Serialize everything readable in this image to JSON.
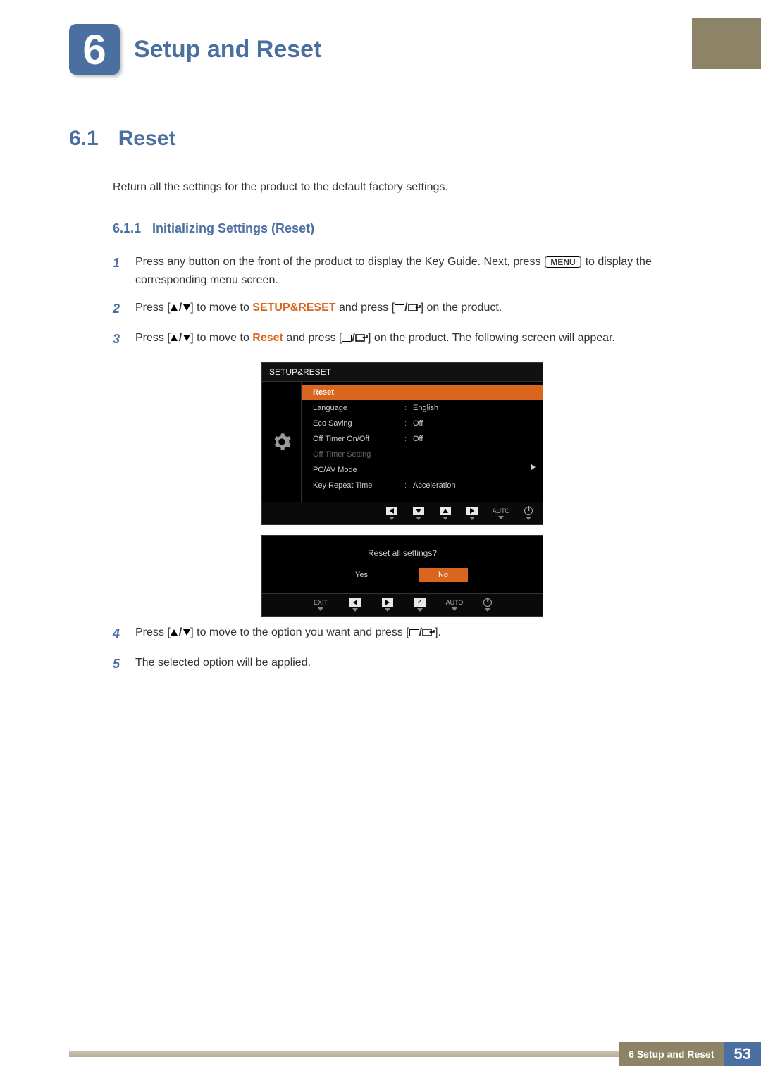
{
  "chapter": {
    "num": "6",
    "title": "Setup and Reset"
  },
  "section": {
    "num": "6.1",
    "title": "Reset"
  },
  "intro": "Return all the settings for the product to the default factory settings.",
  "subsection": {
    "num": "6.1.1",
    "title": "Initializing Settings (Reset)"
  },
  "menuLabel": "MENU",
  "steps": {
    "s1a": "Press any button on the front of the product to display the Key Guide. Next, press [",
    "s1b": "] to display the corresponding menu screen.",
    "s2a": "Press [",
    "s2b": "] to move to ",
    "s2c": "SETUP&RESET",
    "s2d": " and press [",
    "s2e": "] on the product.",
    "s3a": "Press [",
    "s3b": "] to move to ",
    "s3c": "Reset",
    "s3d": " and press [",
    "s3e": "] on the product. The following screen will appear.",
    "s4a": "Press [",
    "s4b": "] to move to the option you want and press [",
    "s4c": "].",
    "s5": "The selected option will be applied."
  },
  "osd": {
    "header": "SETUP&RESET",
    "items": [
      {
        "label": "Reset",
        "value": "",
        "selected": true
      },
      {
        "label": "Language",
        "value": "English"
      },
      {
        "label": "Eco Saving",
        "value": "Off"
      },
      {
        "label": "Off Timer On/Off",
        "value": "Off"
      },
      {
        "label": "Off Timer Setting",
        "value": "",
        "dim": true
      },
      {
        "label": "PC/AV Mode",
        "value": "",
        "caret": true
      },
      {
        "label": "Key Repeat Time",
        "value": "Acceleration"
      }
    ],
    "navAuto": "AUTO"
  },
  "dialog": {
    "question": "Reset all settings?",
    "yes": "Yes",
    "no": "No",
    "exit": "EXIT",
    "auto": "AUTO"
  },
  "footer": {
    "label": "6 Setup and Reset",
    "page": "53"
  }
}
